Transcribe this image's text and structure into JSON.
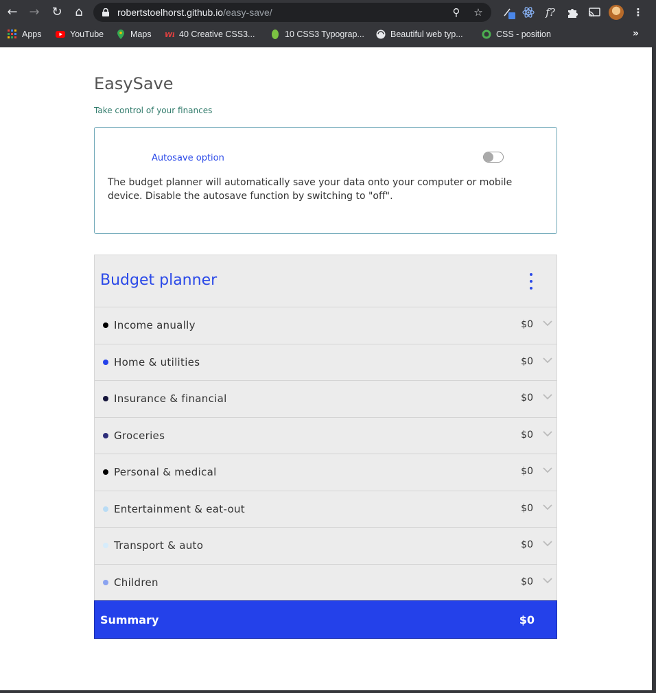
{
  "browser": {
    "url_host": "robertstoelhorst.github.io",
    "url_path": "/easy-save/",
    "bookmarks": [
      {
        "label": "Apps",
        "icon": "apps-grid-icon"
      },
      {
        "label": "YouTube",
        "icon": "youtube-icon"
      },
      {
        "label": "Maps",
        "icon": "maps-pin-icon"
      },
      {
        "label": "40 Creative CSS3...",
        "icon": "webdesign-icon"
      },
      {
        "label": "10 CSS3 Typograp...",
        "icon": "leaf-icon"
      },
      {
        "label": "Beautiful web typ...",
        "icon": "globe-icon"
      },
      {
        "label": "CSS - position",
        "icon": "w3-icon"
      }
    ],
    "more_bookmarks": "»"
  },
  "app": {
    "title": "EasySave",
    "tagline": "Take control of your finances"
  },
  "autosave": {
    "label": "Autosave option",
    "enabled": false,
    "description": "The budget planner will automatically save your data onto your computer or mobile device. Disable the autosave function by switching to \"off\"."
  },
  "planner": {
    "title": "Budget planner",
    "categories": [
      {
        "label": "Income anually",
        "amount": "$0",
        "dot_color": "#000000"
      },
      {
        "label": "Home & utilities",
        "amount": "$0",
        "dot_color": "#2441ea"
      },
      {
        "label": "Insurance & financial",
        "amount": "$0",
        "dot_color": "#14143a"
      },
      {
        "label": "Groceries",
        "amount": "$0",
        "dot_color": "#2e2e7a"
      },
      {
        "label": "Personal & medical",
        "amount": "$0",
        "dot_color": "#000000"
      },
      {
        "label": "Entertainment & eat-out",
        "amount": "$0",
        "dot_color": "#b9dcf5"
      },
      {
        "label": "Transport & auto",
        "amount": "$0",
        "dot_color": "#d6ecfb"
      },
      {
        "label": "Children",
        "amount": "$0",
        "dot_color": "#8aa3f0"
      }
    ],
    "summary_label": "Summary",
    "summary_amount": "$0"
  },
  "colors": {
    "accent": "#2441ea",
    "tagline": "#2f7a6a",
    "box_border": "#6fa8b8"
  }
}
